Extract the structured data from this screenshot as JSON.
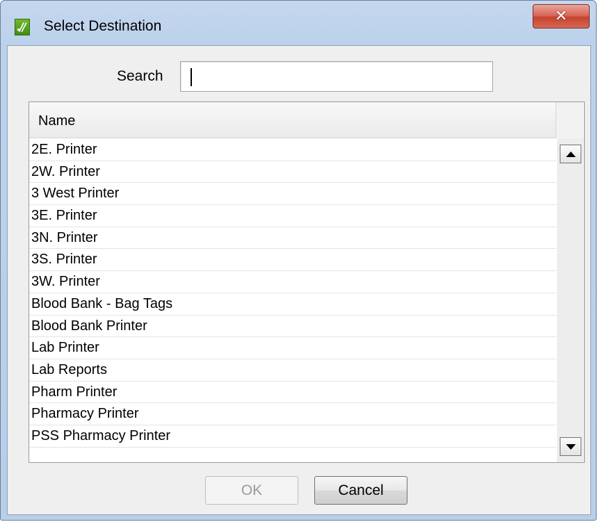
{
  "window": {
    "title": "Select Destination",
    "app_icon": "app-logo-icon",
    "close_glyph": "✕"
  },
  "search": {
    "label": "Search",
    "value": ""
  },
  "list": {
    "column_header": "Name",
    "items": [
      "2E. Printer",
      "2W. Printer",
      "3 West Printer",
      "3E. Printer",
      "3N. Printer",
      "3S. Printer",
      "3W. Printer",
      "Blood Bank - Bag Tags",
      "Blood Bank Printer",
      "Lab Printer",
      "Lab Reports",
      "Pharm Printer",
      "Pharmacy Printer",
      "PSS Pharmacy Printer"
    ]
  },
  "buttons": {
    "ok_label": "OK",
    "cancel_label": "Cancel"
  },
  "colors": {
    "titlebar": "#bcd1ec",
    "close_button": "#c7422f",
    "client_background": "#efefef"
  }
}
